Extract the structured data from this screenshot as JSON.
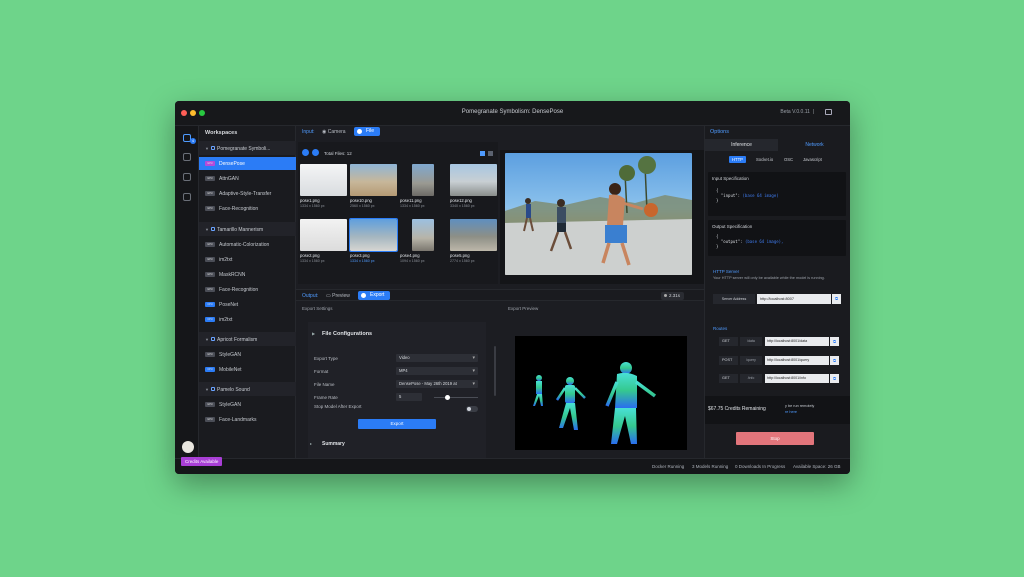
{
  "window": {
    "title": "Pomegranate Symbolism: DensePose",
    "version": "Beta V.0.0.11",
    "version_sep": "|"
  },
  "colors": {
    "accent": "#2b7cf6",
    "selected_tag": "#b44bd9",
    "credits_badge": "#a93fd6",
    "stop_button": "#e2757b",
    "background": "#6ed48a"
  },
  "rail": {
    "badge": "4"
  },
  "sidebar": {
    "title": "Workspaces",
    "groups": [
      {
        "name": "Pomegranate Symboli...",
        "items": [
          {
            "tag": "GPU",
            "label": "DensePose",
            "selected": true
          },
          {
            "tag": "GPU",
            "label": "AttnGAN"
          },
          {
            "tag": "GPU",
            "label": "Adaptive-Style-Transfer"
          },
          {
            "tag": "GPU",
            "label": "Face-Recognition"
          }
        ]
      },
      {
        "name": "Tamarillo Mannerism",
        "items": [
          {
            "tag": "GPU",
            "label": "Automatic-Colorization"
          },
          {
            "tag": "GPU",
            "label": "im2txt"
          },
          {
            "tag": "GPU",
            "label": "MaskRCNN"
          },
          {
            "tag": "GPU",
            "label": "Face-Recognition"
          },
          {
            "tag": "CPU",
            "label": "PoseNet"
          },
          {
            "tag": "CPU",
            "label": "im2txt"
          }
        ]
      },
      {
        "name": "Apricot Formalism",
        "items": [
          {
            "tag": "GPU",
            "label": "StyleGAN"
          },
          {
            "tag": "CPU",
            "label": "MobileNet"
          }
        ]
      },
      {
        "name": "Pamelo Sound",
        "items": [
          {
            "tag": "GPU",
            "label": "StyleGAN"
          },
          {
            "tag": "GPU",
            "label": "Face-Landmarks"
          }
        ]
      }
    ],
    "credits_label": "Credits Available"
  },
  "input": {
    "label": "Input:",
    "camera": "Camera",
    "file": "File",
    "total_files": "Total Files: 12",
    "files": [
      {
        "name": "pose1.png",
        "size": "1334 x 1560 px"
      },
      {
        "name": "pose10.png",
        "size": "2560 x 1560 px"
      },
      {
        "name": "pose11.png",
        "size": "1334 x 1560 px"
      },
      {
        "name": "pose12.png",
        "size": "3340 x 1560 px"
      },
      {
        "name": "pose2.png",
        "size": "1334 x 1560 px"
      },
      {
        "name": "pose3.png",
        "size": "1334 x 1560 px",
        "selected": true
      },
      {
        "name": "pose4.png",
        "size": "1094 x 1560 px"
      },
      {
        "name": "pose5.png",
        "size": "2774 x 1560 px"
      }
    ]
  },
  "output": {
    "label": "Output:",
    "preview": "Preview",
    "export": "Export",
    "timer": "2.31s"
  },
  "export_settings": {
    "title": "Export Settings",
    "section": "File Configurations",
    "fields": [
      {
        "label": "Export Type",
        "value": "Video"
      },
      {
        "label": "Format",
        "value": "MP4"
      },
      {
        "label": "File Name",
        "value": "DensePose - May 26th 2019 at"
      }
    ],
    "frame_rate_label": "Frame Rate",
    "frame_rate": "5",
    "frame_rate_fraction": 0.3,
    "stop_label": "Stop Model After Export",
    "export_button": "Export",
    "summary": "Summary"
  },
  "export_preview": {
    "title": "Export Preview"
  },
  "options": {
    "title": "Options",
    "tabs": [
      "Inference",
      "Network"
    ],
    "protocols": [
      "HTTP",
      "Socket.io",
      "OSC",
      "Javascript"
    ],
    "input_spec_title": "Input Specification",
    "input_spec": {
      "brace_open": "{",
      "key": "\"input\":",
      "value": "(base 64 image)",
      "brace_close": "}"
    },
    "output_spec_title": "Output Specification",
    "output_spec": {
      "brace_open": "{",
      "key": "\"output\":",
      "value": "(base 64 image),",
      "brace_close": "}"
    },
    "http_server_title": "HTTP Server",
    "http_server_desc": "Your HTTP server will only be available while the model is running.",
    "server_address_label": "Server Address",
    "server_address": "http://localhost:8007",
    "routes_title": "Routes",
    "routes": [
      {
        "method": "GET",
        "endpoint": "/data",
        "url": "http://localhost:8001/data"
      },
      {
        "method": "POST",
        "endpoint": "/query",
        "url": "http://localhost:8001/query"
      },
      {
        "method": "GET",
        "endpoint": "/info",
        "url": "http://localhost:8001/info"
      }
    ],
    "credits_remaining": "$67.75 Credits Remaining",
    "run_note": "y be run remotely",
    "learn_more": "re here",
    "stop_button": "Stop"
  },
  "status_bar": [
    "Docker Running",
    "3 Models Running",
    "0 Downloads In Progress",
    "Available Space: 26 GB"
  ]
}
